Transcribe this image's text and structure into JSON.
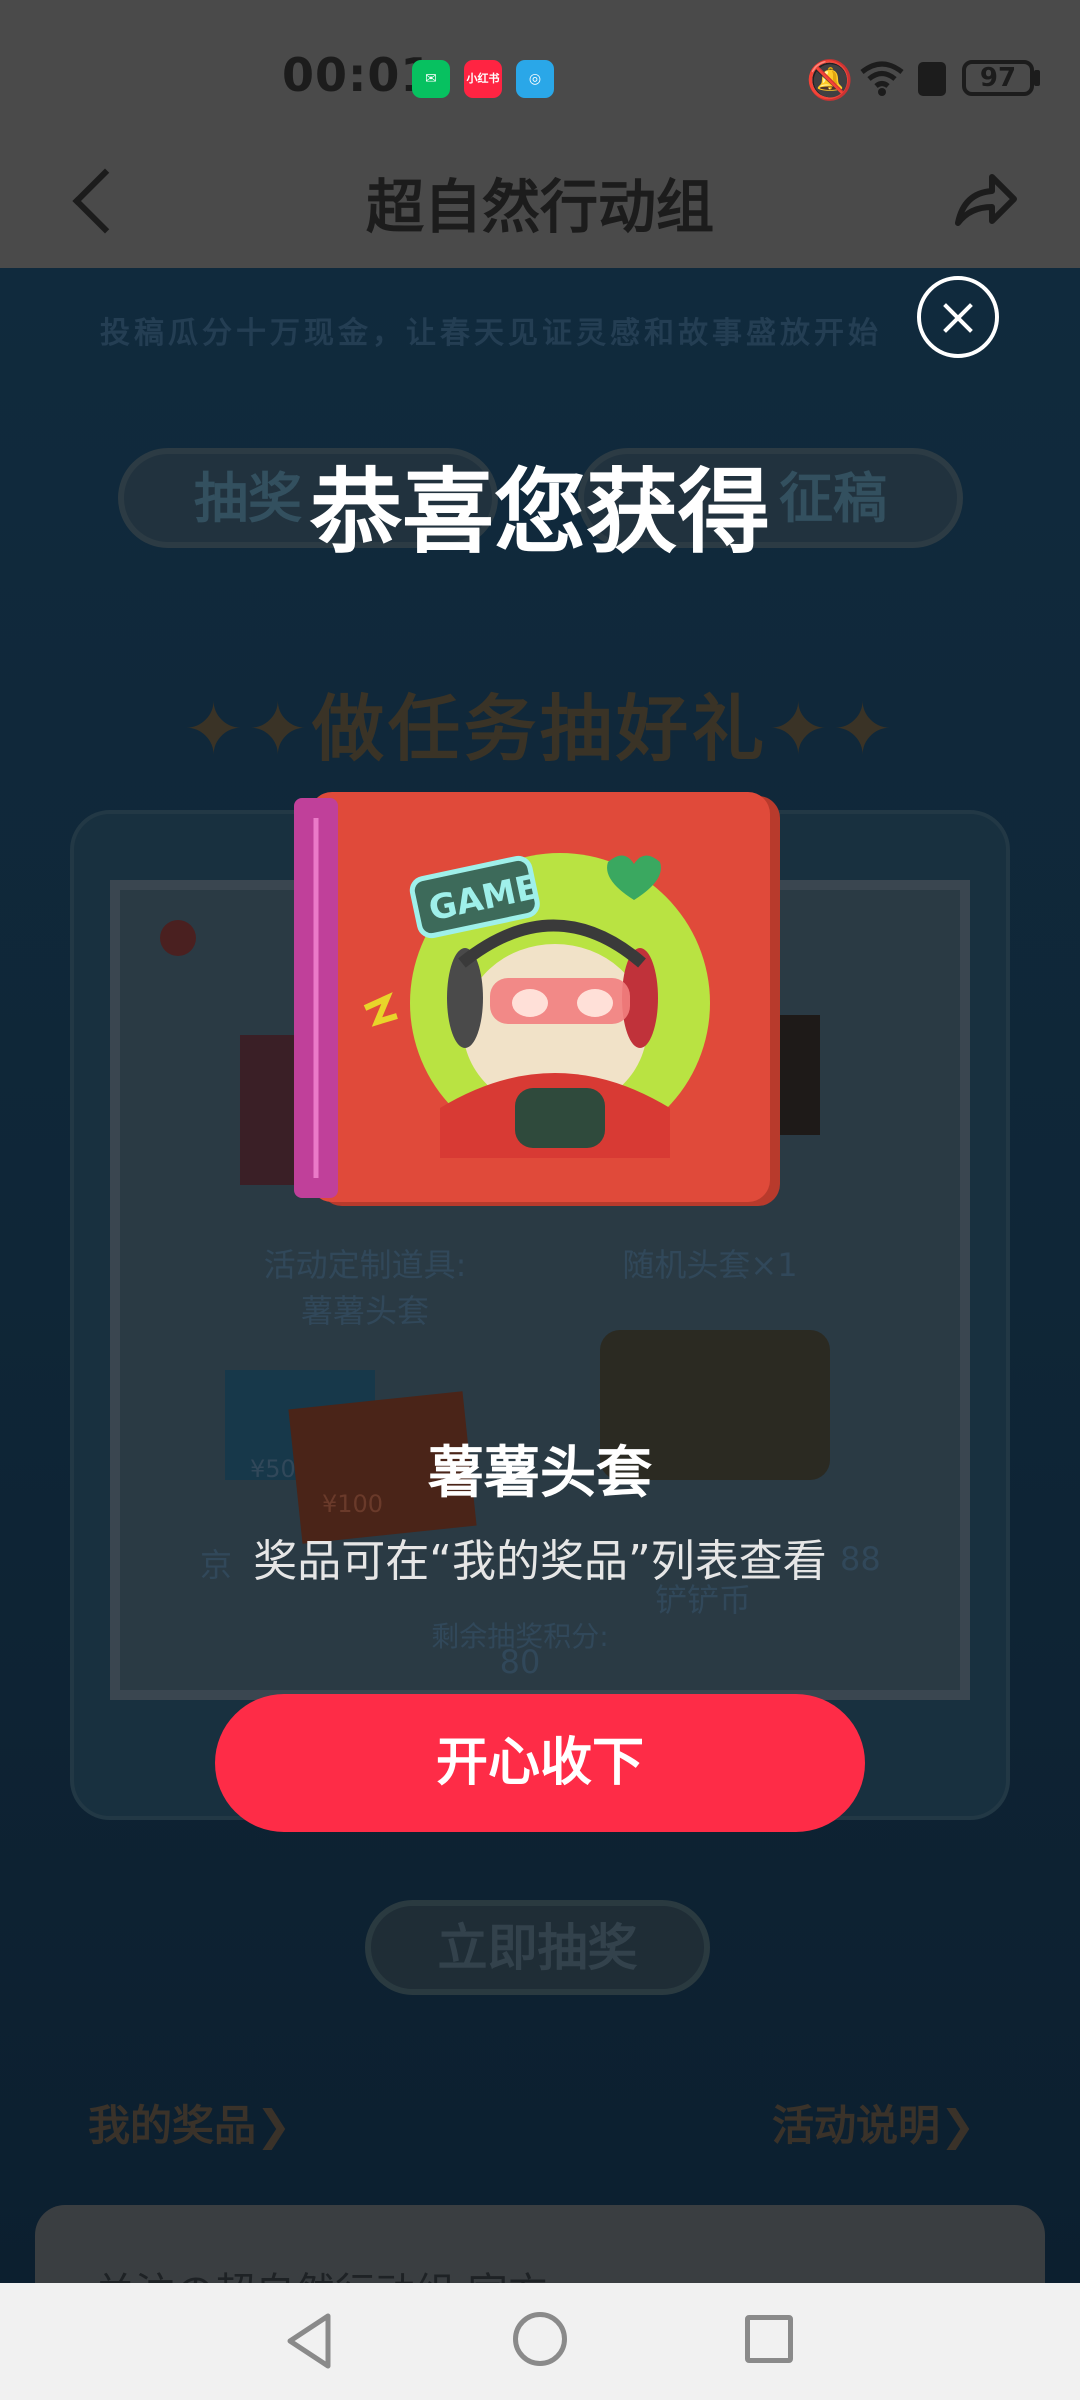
{
  "status_bar": {
    "time": "00:01",
    "apps": [
      {
        "name": "wechat-icon",
        "color": "#07c160"
      },
      {
        "name": "xiaohongshu-icon",
        "label": "小红书",
        "color": "#ff2442"
      },
      {
        "name": "browser-icon",
        "color": "#2aa7e8"
      }
    ],
    "battery": "97"
  },
  "header": {
    "title": "超自然行动组"
  },
  "page": {
    "banner": "投稿瓜分十万现金，让春天见证灵感和故事盛放开始",
    "tabs": [
      "抽奖",
      "征稿"
    ],
    "section_title": "做任务抽好礼",
    "prizes": [
      "活动定制道具:",
      "薯薯头套",
      "随机头套×1",
      "京",
      "¥50",
      "¥100",
      "88",
      "铲铲币"
    ],
    "points_label": "剩余抽奖积分:",
    "points_value": "80",
    "lottery_button": "立即抽奖",
    "my_prizes_link": "我的奖品",
    "rules_link": "活动说明",
    "bottom_card_text": "关注の超自然行动组 官方"
  },
  "popup": {
    "heading": "恭喜您获得",
    "prize_name": "薯薯头套",
    "hint": "奖品可在“我的奖品”列表查看",
    "accept_button": "开心收下",
    "badge_text": "GAME"
  },
  "colors": {
    "accent": "#fe2c47",
    "overlay": "#000000"
  }
}
